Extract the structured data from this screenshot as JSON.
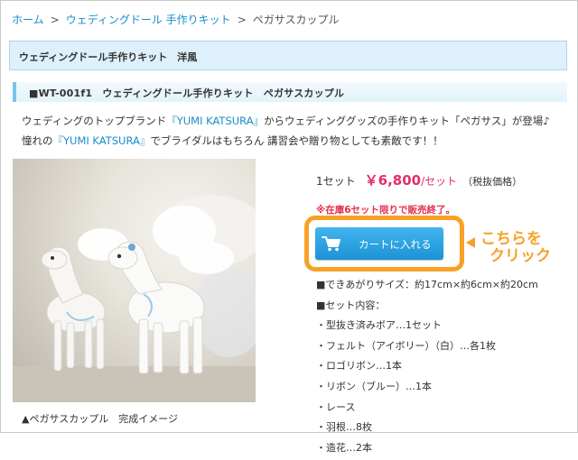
{
  "breadcrumb": {
    "home": "ホーム",
    "separator": ">",
    "category": "ウェディングドール 手作りキット",
    "current": "ペガサスカップル"
  },
  "category_bar": {
    "label": "ウェディングドール手作りキット　洋風"
  },
  "product": {
    "title": "■WT-001f1　ウェディングドール手作りキット　ペガサスカップル",
    "desc_line1": {
      "pre": "ウェディングのトップブランド",
      "brand": "『YUMI KATSURA』",
      "post": "からウェディンググッズの手作りキット「ペガサス」が登場♪"
    },
    "desc_line2": {
      "pre": "憧れの",
      "brand": "『YUMI KATSURA』",
      "post": "でブライダルはもちろん 講習会や贈り物としても素敵です！！"
    },
    "image_caption": "▲ペガサスカップル　完成イメージ"
  },
  "purchase": {
    "quantity": "1セット",
    "price": "￥6,800",
    "unit": "/セット",
    "tax": "（税抜価格）",
    "stock_note": "※在庫6セット限りで販売終了。",
    "cart_button": "カートに入れる",
    "callout_line1": "こちらを",
    "callout_line2": "クリック"
  },
  "specs": [
    "■できあがりサイズ：約17cm×約6cm×約20cm",
    "■セット内容：",
    "・型抜き済みボア…1セット",
    "・フェルト（アイボリー）（白）…各1枚",
    "・ロゴリボン…1本",
    "・リボン（ブルー）…1本",
    "・レース",
    "・羽根…8枚",
    "・造花…2本"
  ],
  "colors": {
    "link": "#1a8cc8",
    "price": "#e32d6e",
    "stock_note": "#e3304f",
    "cart_button": "#1a93d6",
    "highlight": "#f7a127",
    "category_bar_bg": "#ddf0fb"
  },
  "icons": {
    "cart": "shopping-cart-icon",
    "callout": "arrow-left-icon"
  }
}
